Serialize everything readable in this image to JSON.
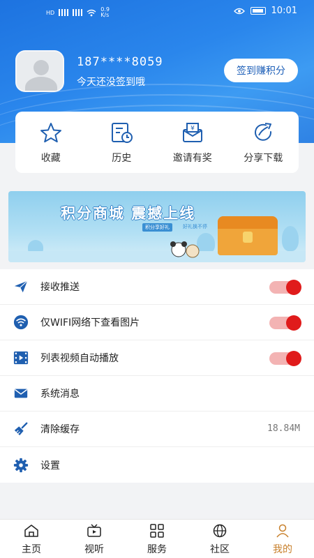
{
  "status_bar": {
    "carrier_left": "HD",
    "speed_value": "0.9",
    "speed_unit": "K/s",
    "time": "10:01"
  },
  "profile": {
    "phone": "187****8059",
    "sign_message": "今天还没签到哦",
    "sign_button": "签到赚积分"
  },
  "quick_actions": [
    {
      "label": "收藏",
      "icon": "star-icon"
    },
    {
      "label": "历史",
      "icon": "history-icon"
    },
    {
      "label": "邀请有奖",
      "icon": "invite-icon"
    },
    {
      "label": "分享下载",
      "icon": "share-icon"
    }
  ],
  "banner": {
    "title": "积分商城 震撼上线",
    "tag1": "积分享好礼",
    "tag2": "好礼换不停"
  },
  "settings": [
    {
      "label": "接收推送",
      "icon": "send-icon",
      "toggle": true
    },
    {
      "label": "仅WIFI网络下查看图片",
      "icon": "wifi-icon",
      "toggle": true
    },
    {
      "label": "列表视频自动播放",
      "icon": "video-icon",
      "toggle": true
    },
    {
      "label": "系统消息",
      "icon": "mail-icon",
      "toggle": false
    },
    {
      "label": "清除缓存",
      "icon": "broom-icon",
      "value": "18.84M"
    },
    {
      "label": "设置",
      "icon": "gear-icon",
      "toggle": false
    }
  ],
  "tabs": [
    {
      "label": "主页",
      "icon": "home-icon",
      "active": false
    },
    {
      "label": "视听",
      "icon": "tv-icon",
      "active": false
    },
    {
      "label": "服务",
      "icon": "grid-icon",
      "active": false
    },
    {
      "label": "社区",
      "icon": "globe-icon",
      "active": false
    },
    {
      "label": "我的",
      "icon": "person-icon",
      "active": true
    }
  ],
  "colors": {
    "header_blue": "#1d73e0",
    "toggle_on": "#e01b1b",
    "active_tab": "#c8802c",
    "icon_blue": "#1f5fb0"
  }
}
